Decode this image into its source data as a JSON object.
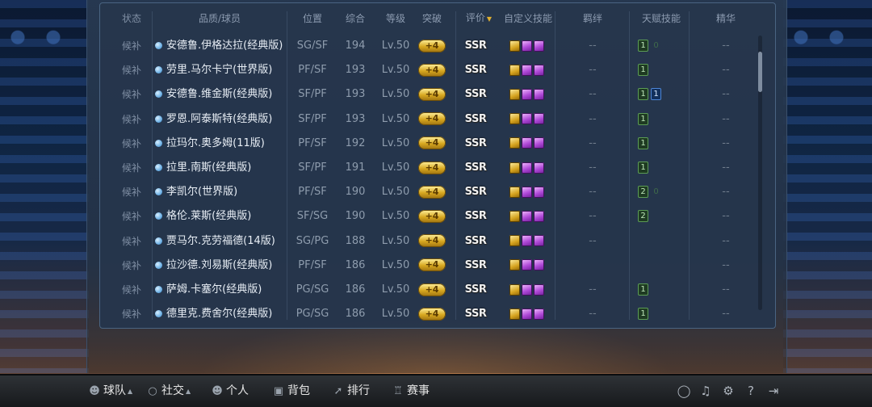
{
  "header": {
    "status": "状态",
    "name": "品质/球员",
    "position": "位置",
    "overall": "综合",
    "level": "等级",
    "breakthrough": "突破",
    "rating": "评价",
    "rating_sort": "▼",
    "custom_skills": "自定义技能",
    "bond": "羁绊",
    "talent": "天赋技能",
    "essence": "精华"
  },
  "rows": [
    {
      "status": "候补",
      "name": "安德鲁.伊格达拉(经典版)",
      "pos": "SG/SF",
      "ovr": "194",
      "lv": "Lv.50",
      "brk": "+4",
      "rate": "SSR",
      "bond": "--",
      "tal": [
        "1"
      ],
      "tal_faint": "0",
      "ess": "--"
    },
    {
      "status": "候补",
      "name": "劳里.马尔卡宁(世界版)",
      "pos": "PF/SF",
      "ovr": "193",
      "lv": "Lv.50",
      "brk": "+4",
      "rate": "SSR",
      "bond": "--",
      "tal": [
        "1"
      ],
      "tal_faint": "",
      "ess": "--"
    },
    {
      "status": "候补",
      "name": "安德鲁.维金斯(经典版)",
      "pos": "SF/PF",
      "ovr": "193",
      "lv": "Lv.50",
      "brk": "+4",
      "rate": "SSR",
      "bond": "--",
      "tal": [
        "1"
      ],
      "tal_blue": "1",
      "ess": "--"
    },
    {
      "status": "候补",
      "name": "罗恩.阿泰斯特(经典版)",
      "pos": "SF/PF",
      "ovr": "193",
      "lv": "Lv.50",
      "brk": "+4",
      "rate": "SSR",
      "bond": "--",
      "tal": [
        "1"
      ],
      "ess": "--"
    },
    {
      "status": "候补",
      "name": "拉玛尔.奥多姆(11版)",
      "pos": "PF/SF",
      "ovr": "192",
      "lv": "Lv.50",
      "brk": "+4",
      "rate": "SSR",
      "bond": "--",
      "tal": [
        "1"
      ],
      "ess": "--"
    },
    {
      "status": "候补",
      "name": "拉里.南斯(经典版)",
      "pos": "SF/PF",
      "ovr": "191",
      "lv": "Lv.50",
      "brk": "+4",
      "rate": "SSR",
      "bond": "--",
      "tal": [
        "1"
      ],
      "ess": "--"
    },
    {
      "status": "候补",
      "name": "李凯尔(世界版)",
      "pos": "PF/SF",
      "ovr": "190",
      "lv": "Lv.50",
      "brk": "+4",
      "rate": "SSR",
      "bond": "--",
      "tal": [
        "2"
      ],
      "tal_faint": "0",
      "ess": "--"
    },
    {
      "status": "候补",
      "name": "格伦.莱斯(经典版)",
      "pos": "SF/SG",
      "ovr": "190",
      "lv": "Lv.50",
      "brk": "+4",
      "rate": "SSR",
      "bond": "--",
      "tal": [
        "2"
      ],
      "ess": "--"
    },
    {
      "status": "候补",
      "name": "贾马尔.克劳福德(14版)",
      "pos": "SG/PG",
      "ovr": "188",
      "lv": "Lv.50",
      "brk": "+4",
      "rate": "SSR",
      "bond": "--",
      "tal": [],
      "ess": "--"
    },
    {
      "status": "候补",
      "name": "拉沙德.刘易斯(经典版)",
      "pos": "PF/SF",
      "ovr": "186",
      "lv": "Lv.50",
      "brk": "+4",
      "rate": "SSR",
      "bond": "",
      "tal": [],
      "ess": "--"
    },
    {
      "status": "候补",
      "name": "萨姆.卡塞尔(经典版)",
      "pos": "PG/SG",
      "ovr": "186",
      "lv": "Lv.50",
      "brk": "+4",
      "rate": "SSR",
      "bond": "--",
      "tal": [
        "1"
      ],
      "ess": "--"
    },
    {
      "status": "候补",
      "name": "德里克.费舍尔(经典版)",
      "pos": "PG/SG",
      "ovr": "186",
      "lv": "Lv.50",
      "brk": "+4",
      "rate": "SSR",
      "bond": "--",
      "tal": [
        "1"
      ],
      "ess": "--"
    }
  ],
  "nav": {
    "team": "球队",
    "social": "社交",
    "personal": "个人",
    "bag": "背包",
    "rank": "排行",
    "events": "赛事"
  },
  "icons": {
    "team": "person-icon",
    "social": "chat-icon",
    "personal": "person-icon",
    "bag": "bag-icon",
    "rank": "ranking-icon",
    "events": "trophy-icon",
    "tools": [
      "support-icon",
      "music-icon",
      "settings-icon",
      "help-icon",
      "exit-icon"
    ]
  }
}
